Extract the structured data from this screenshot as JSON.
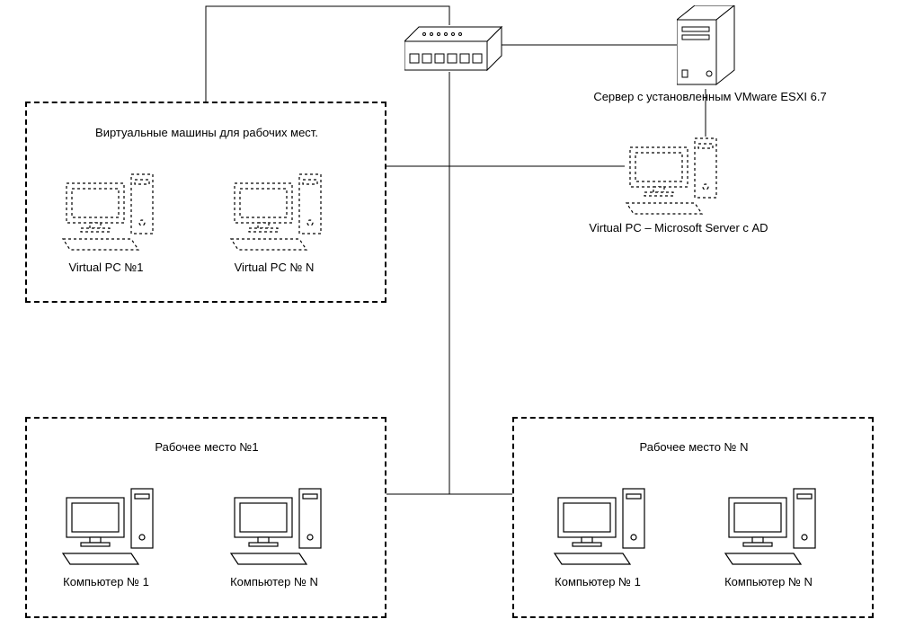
{
  "groups": {
    "vms": {
      "title": "Виртуальные машины для рабочих мест.",
      "items": [
        {
          "label": "Virtual PC №1"
        },
        {
          "label": "Virtual PC № N"
        }
      ]
    },
    "workstation1": {
      "title": "Рабочее место №1",
      "items": [
        {
          "label": "Компьютер № 1"
        },
        {
          "label": "Компьютер № N"
        }
      ]
    },
    "workstationN": {
      "title": "Рабочее место № N",
      "items": [
        {
          "label": "Компьютер № 1"
        },
        {
          "label": "Компьютер № N"
        }
      ]
    }
  },
  "server": {
    "label": "Сервер с установленным VMware ESXI 6.7"
  },
  "adserver": {
    "label": "Virtual PC – Microsoft Server с AD"
  }
}
